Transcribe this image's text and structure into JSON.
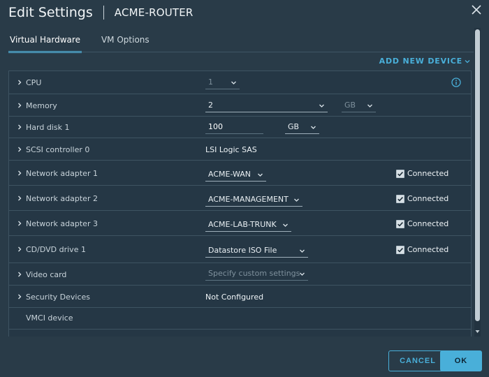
{
  "header": {
    "title": "Edit Settings",
    "vm_name": "ACME-ROUTER"
  },
  "tabs": [
    {
      "label": "Virtual Hardware",
      "active": true
    },
    {
      "label": "VM Options",
      "active": false
    }
  ],
  "add_new_device": "ADD NEW DEVICE",
  "rows": {
    "cpu": {
      "label": "CPU",
      "value": "1"
    },
    "memory": {
      "label": "Memory",
      "value": "2",
      "unit": "GB"
    },
    "hard_disk": {
      "label": "Hard disk 1",
      "value": "100",
      "unit": "GB"
    },
    "scsi": {
      "label": "SCSI controller 0",
      "value": "LSI Logic SAS"
    },
    "net1": {
      "label": "Network adapter 1",
      "value": "ACME-WAN",
      "connected_label": "Connected",
      "connected": true
    },
    "net2": {
      "label": "Network adapter 2",
      "value": "ACME-MANAGEMENT",
      "connected_label": "Connected",
      "connected": true
    },
    "net3": {
      "label": "Network adapter 3",
      "value": "ACME-LAB-TRUNK",
      "connected_label": "Connected",
      "connected": true
    },
    "cddvd": {
      "label": "CD/DVD drive 1",
      "value": "Datastore ISO File",
      "connected_label": "Connected",
      "connected": true
    },
    "video": {
      "label": "Video card",
      "value": "Specify custom settings"
    },
    "security": {
      "label": "Security Devices",
      "value": "Not Configured"
    },
    "vmci": {
      "label": "VMCI device"
    }
  },
  "footer": {
    "cancel": "CANCEL",
    "ok": "OK"
  },
  "colors": {
    "accent": "#49afd9",
    "background": "#293b48",
    "panel": "#253745"
  }
}
